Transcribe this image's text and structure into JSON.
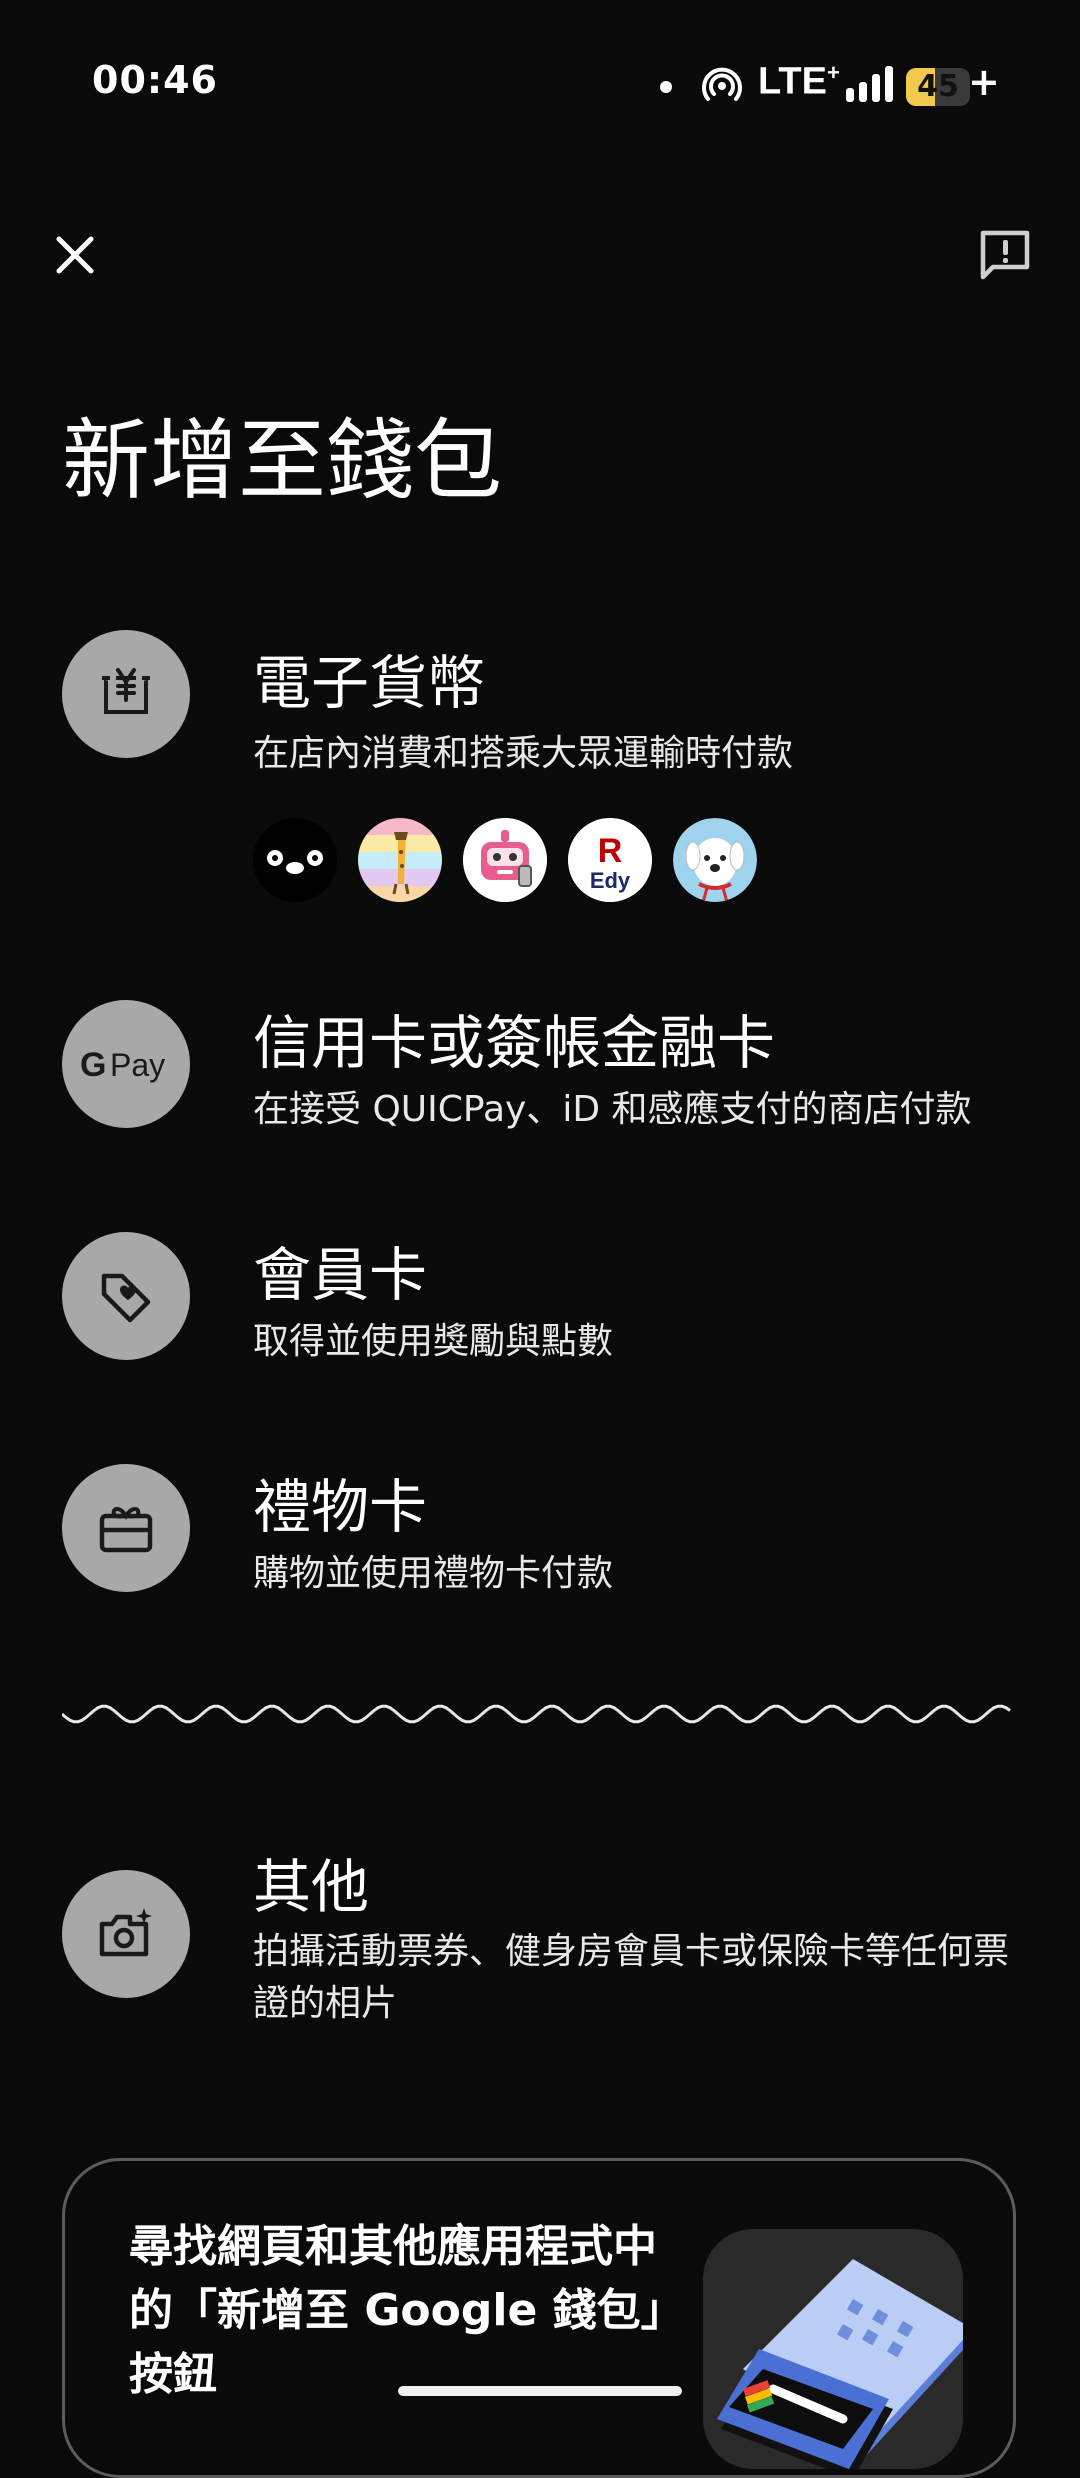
{
  "status_bar": {
    "time": "00:46",
    "network": "LTE",
    "network_plus": "+",
    "battery_level": "45",
    "battery_fraction": 0.45,
    "battery_charging": "+"
  },
  "header": {
    "close_icon": "close-icon",
    "feedback_icon": "feedback-icon"
  },
  "title": "新增至錢包",
  "options": [
    {
      "title": "電子貨幣",
      "subtitle": "在店內消費和搭乘大眾運輸時付款",
      "icon": "yen-wallet-icon",
      "logos": [
        "suica-logo",
        "manaca-logo",
        "pasmo-robot-logo",
        "rakuten-edy-logo",
        "waon-logo"
      ],
      "edy_letter": "R",
      "edy_text": "Edy"
    },
    {
      "title": "信用卡或簽帳金融卡",
      "subtitle": "在接受 QUICPay、iD 和感應支付的商店付款",
      "icon": "google-pay-icon",
      "icon_text": "Pay"
    },
    {
      "title": "會員卡",
      "subtitle": "取得並使用獎勵與點數",
      "icon": "loyalty-tag-icon"
    },
    {
      "title": "禮物卡",
      "subtitle": "購物並使用禮物卡付款",
      "icon": "gift-card-icon"
    },
    {
      "title": "其他",
      "subtitle": "拍攝活動票券、健身房會員卡或保險卡等任何票證的相片",
      "icon": "camera-sparkle-icon"
    }
  ],
  "promo": {
    "text": "尋找網頁和其他應用程式中的「新增至 Google 錢包」按鈕",
    "art": "wallet-card-illustration"
  },
  "colors": {
    "background": "#0a0a0a",
    "icon_circle": "#a8a8a8",
    "battery": "#f2c94c"
  }
}
